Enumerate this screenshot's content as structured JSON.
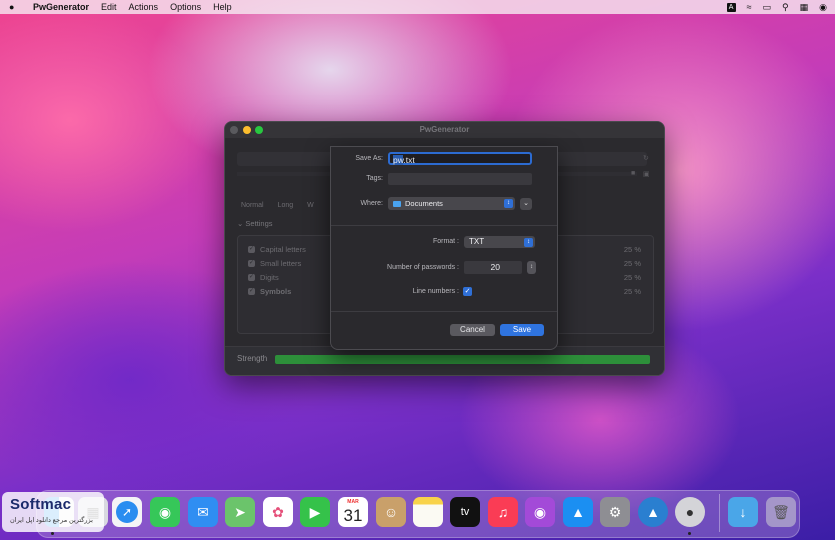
{
  "menubar": {
    "app_name": "PwGenerator",
    "items": [
      "Edit",
      "Actions",
      "Options",
      "Help"
    ],
    "status_icons": [
      "keyboard-input-icon",
      "wifi-icon",
      "battery-icon",
      "search-icon",
      "control-center-icon",
      "siri-icon"
    ],
    "input_letter": "A"
  },
  "window": {
    "title": "PwGenerator",
    "modes": [
      "Normal",
      "Long",
      "W"
    ],
    "settings_label": "Settings",
    "settings": [
      {
        "label": "Capital letters",
        "percent": "25 %"
      },
      {
        "label": "Small letters",
        "percent": "25 %"
      },
      {
        "label": "Digits",
        "percent": "25 %"
      },
      {
        "label": "Symbols",
        "percent": "25 %"
      }
    ],
    "strength_label": "Strength",
    "strength_fraction": 1.0
  },
  "save_sheet": {
    "save_as_label": "Save As:",
    "filename_selected": "pw",
    "filename_rest": ".txt",
    "tags_label": "Tags:",
    "where_label": "Where:",
    "where_value": "Documents",
    "format_label": "Format :",
    "format_value": "TXT",
    "num_passwords_label": "Number of passwords :",
    "num_passwords_value": "20",
    "line_numbers_label": "Line numbers :",
    "line_numbers_checked": true,
    "cancel_label": "Cancel",
    "save_label": "Save"
  },
  "dock": {
    "calendar_month": "MAR",
    "calendar_day": "31",
    "tv_label": "tv",
    "items": [
      "finder",
      "launchpad",
      "safari",
      "messages",
      "mail",
      "maps",
      "photos",
      "facetime",
      "calendar",
      "contacts",
      "notes",
      "apple-tv",
      "music",
      "podcasts",
      "app-store",
      "system-preferences",
      "altimeter",
      "pwgenerator",
      "downloads",
      "trash"
    ]
  },
  "watermark": {
    "name": "Softmac",
    "subtitle": "بزرگترین مرجع دانلود اپل ایران"
  },
  "colors": {
    "accent": "#2f74e0",
    "strength": "#2d8f3a",
    "window_bg": "#2b2a2e"
  }
}
